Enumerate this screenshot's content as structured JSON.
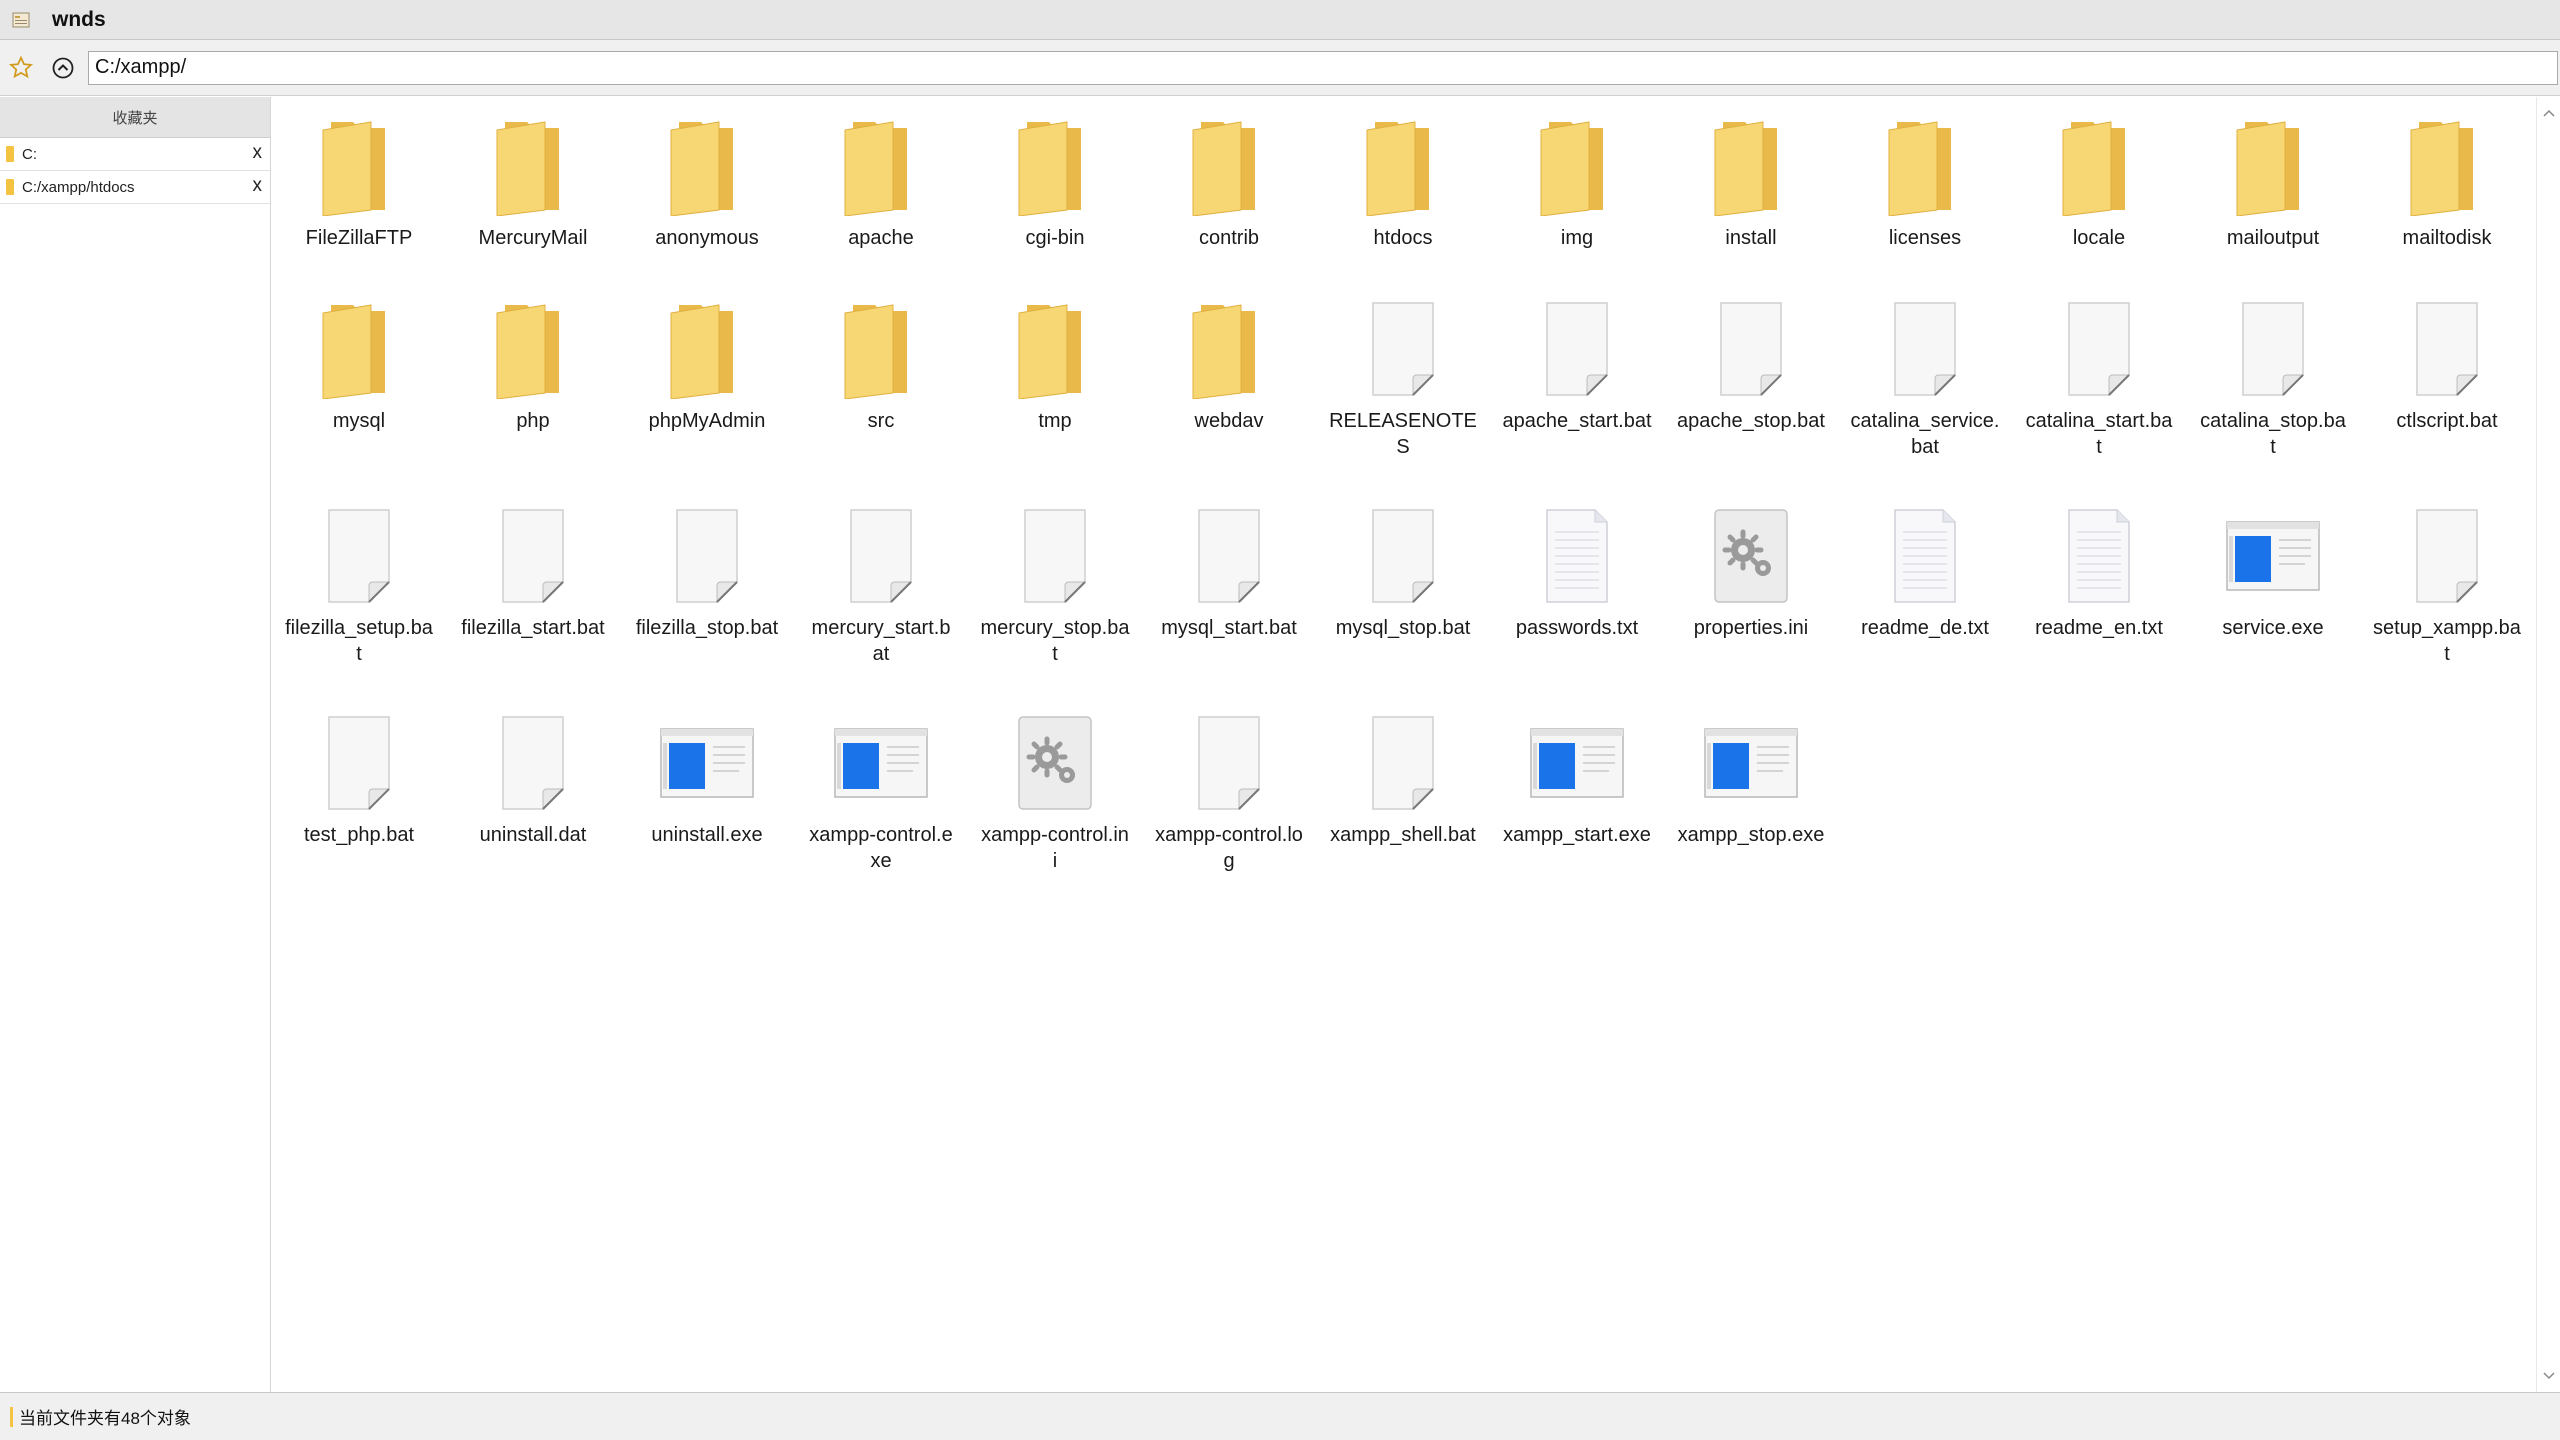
{
  "window": {
    "title": "wnds",
    "app_icon": "explorer-app-icon"
  },
  "address_bar": {
    "path": "C:/xampp/",
    "star_icon": "star-icon",
    "up_icon": "up-arrow-circle-icon"
  },
  "sidebar": {
    "header": "收藏夹",
    "items": [
      {
        "label": "C:",
        "close": "x"
      },
      {
        "label": "C:/xampp/htdocs",
        "close": "x"
      }
    ]
  },
  "files": [
    {
      "name": "FileZillaFTP",
      "type": "folder"
    },
    {
      "name": "MercuryMail",
      "type": "folder"
    },
    {
      "name": "anonymous",
      "type": "folder"
    },
    {
      "name": "apache",
      "type": "folder"
    },
    {
      "name": "cgi-bin",
      "type": "folder"
    },
    {
      "name": "contrib",
      "type": "folder"
    },
    {
      "name": "htdocs",
      "type": "folder"
    },
    {
      "name": "img",
      "type": "folder"
    },
    {
      "name": "install",
      "type": "folder"
    },
    {
      "name": "licenses",
      "type": "folder"
    },
    {
      "name": "locale",
      "type": "folder"
    },
    {
      "name": "mailoutput",
      "type": "folder"
    },
    {
      "name": "mailtodisk",
      "type": "folder"
    },
    {
      "name": "mysql",
      "type": "folder"
    },
    {
      "name": "php",
      "type": "folder"
    },
    {
      "name": "phpMyAdmin",
      "type": "folder"
    },
    {
      "name": "src",
      "type": "folder"
    },
    {
      "name": "tmp",
      "type": "folder"
    },
    {
      "name": "webdav",
      "type": "folder"
    },
    {
      "name": "RELEASENOTES",
      "type": "file"
    },
    {
      "name": "apache_start.bat",
      "type": "file"
    },
    {
      "name": "apache_stop.bat",
      "type": "file"
    },
    {
      "name": "catalina_service.bat",
      "type": "file"
    },
    {
      "name": "catalina_start.bat",
      "type": "file"
    },
    {
      "name": "catalina_stop.bat",
      "type": "file"
    },
    {
      "name": "ctlscript.bat",
      "type": "file"
    },
    {
      "name": "filezilla_setup.bat",
      "type": "file"
    },
    {
      "name": "filezilla_start.bat",
      "type": "file"
    },
    {
      "name": "filezilla_stop.bat",
      "type": "file"
    },
    {
      "name": "mercury_start.bat",
      "type": "file"
    },
    {
      "name": "mercury_stop.bat",
      "type": "file"
    },
    {
      "name": "mysql_start.bat",
      "type": "file"
    },
    {
      "name": "mysql_stop.bat",
      "type": "file"
    },
    {
      "name": "passwords.txt",
      "type": "text"
    },
    {
      "name": "properties.ini",
      "type": "settings"
    },
    {
      "name": "readme_de.txt",
      "type": "text"
    },
    {
      "name": "readme_en.txt",
      "type": "text"
    },
    {
      "name": "service.exe",
      "type": "exe"
    },
    {
      "name": "setup_xampp.bat",
      "type": "file"
    },
    {
      "name": "test_php.bat",
      "type": "file"
    },
    {
      "name": "uninstall.dat",
      "type": "file"
    },
    {
      "name": "uninstall.exe",
      "type": "exe"
    },
    {
      "name": "xampp-control.exe",
      "type": "exe"
    },
    {
      "name": "xampp-control.ini",
      "type": "settings"
    },
    {
      "name": "xampp-control.log",
      "type": "file"
    },
    {
      "name": "xampp_shell.bat",
      "type": "file"
    },
    {
      "name": "xampp_start.exe",
      "type": "exe"
    },
    {
      "name": "xampp_stop.exe",
      "type": "exe"
    }
  ],
  "status": {
    "text": "当前文件夹有48个对象"
  },
  "colors": {
    "folder": "#f7d774",
    "folder_dark": "#e9b949",
    "exe_blue": "#1a73e8",
    "status_mark": "#f5c342"
  }
}
